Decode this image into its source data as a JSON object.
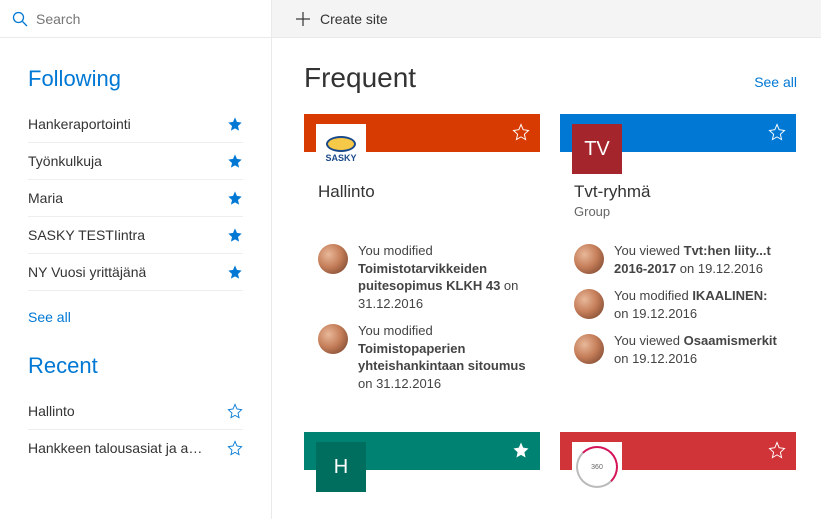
{
  "search": {
    "placeholder": "Search"
  },
  "actions": {
    "create_site": "Create site"
  },
  "sidebar": {
    "following_heading": "Following",
    "following": [
      {
        "label": "Hankeraportointi",
        "starred": true
      },
      {
        "label": "Työnkulkuja",
        "starred": true
      },
      {
        "label": "Maria",
        "starred": true
      },
      {
        "label": "SASKY TESTIintra",
        "starred": true
      },
      {
        "label": "NY Vuosi yrittäjänä",
        "starred": true
      }
    ],
    "see_all": "See all",
    "recent_heading": "Recent",
    "recent": [
      {
        "label": "Hallinto",
        "starred": false
      },
      {
        "label": "Hankkeen talousasiat ja asia...",
        "starred": false
      }
    ]
  },
  "main": {
    "heading": "Frequent",
    "see_all": "See all",
    "cards": [
      {
        "banner_color": "#d83b01",
        "logo_type": "sasky",
        "logo_text": "SASKY",
        "title": "Hallinto",
        "subtitle": "",
        "star_filled": false,
        "activities": [
          {
            "prefix": "You modified ",
            "object": "Toimistotarvikkeiden puitesopimus KLKH 43",
            "suffix": " on 31.12.2016"
          },
          {
            "prefix": "You modified ",
            "object": "Toimistopaperien yhteishankintaan sitoumus",
            "suffix": " on 31.12.2016"
          }
        ]
      },
      {
        "banner_color": "#0078d4",
        "logo_type": "text",
        "logo_bg": "#a4262c",
        "logo_text": "TV",
        "title": "Tvt-ryhmä",
        "subtitle": "Group",
        "star_filled": false,
        "activities": [
          {
            "prefix": "You viewed ",
            "object": "Tvt:hen liity...t 2016-2017",
            "suffix": " on 19.12.2016"
          },
          {
            "prefix": "You modified ",
            "object": "IKAALINEN:",
            "suffix": " on 19.12.2016"
          },
          {
            "prefix": "You viewed ",
            "object": "Osaamismerkit",
            "suffix": " on 19.12.2016"
          }
        ]
      },
      {
        "banner_color": "#008272",
        "logo_type": "text",
        "logo_bg": "#006e5f",
        "logo_text": "H",
        "title": "",
        "subtitle": "",
        "star_filled": true,
        "activities": []
      },
      {
        "banner_color": "#d13438",
        "logo_type": "vasta",
        "logo_text": "360",
        "title": "",
        "subtitle": "",
        "star_filled": false,
        "activities": []
      }
    ]
  }
}
